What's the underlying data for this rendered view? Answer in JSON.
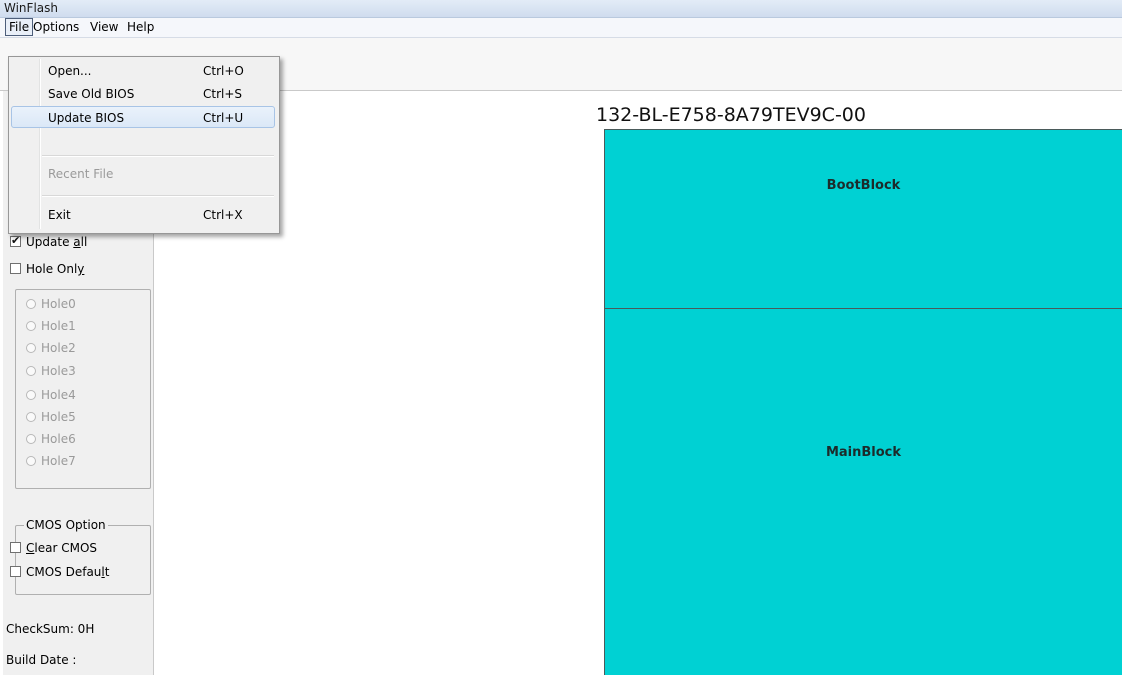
{
  "window": {
    "title": "WinFlash"
  },
  "menubar": {
    "items": [
      "File",
      "Options",
      "View",
      "Help"
    ]
  },
  "file_menu": {
    "open": {
      "label": "Open...",
      "shortcut": "Ctrl+O"
    },
    "save_old_bios": {
      "label": "Save Old BIOS",
      "shortcut": "Ctrl+S"
    },
    "update_bios": {
      "label": "Update BIOS",
      "shortcut": "Ctrl+U"
    },
    "recent_file": {
      "label": "Recent File"
    },
    "exit": {
      "label": "Exit",
      "shortcut": "Ctrl+X"
    }
  },
  "update_options": {
    "update_all": {
      "label_pre": "Update ",
      "label_u": "a",
      "label_post": "ll",
      "checked": true
    },
    "hole_only": {
      "label_pre": "Hole Onl",
      "label_u": "y",
      "checked": false
    },
    "holes": [
      "Hole0",
      "Hole1",
      "Hole2",
      "Hole3",
      "Hole4",
      "Hole5",
      "Hole6",
      "Hole7"
    ]
  },
  "cmos_option": {
    "legend": "CMOS Option",
    "clear_cmos": {
      "label_u": "C",
      "label_post": "lear CMOS",
      "checked": false
    },
    "cmos_default": {
      "label_pre": "CMOS Defau",
      "label_u": "l",
      "label_post": "t",
      "checked": false
    }
  },
  "info": {
    "checksum": "CheckSum:  0H",
    "build_date": "Build Date :"
  },
  "bios_map": {
    "part_number": "132-BL-E758-8A79TEV9C-00",
    "blocks": [
      "BootBlock",
      "MainBlock"
    ],
    "block_color": "#00d1d3"
  }
}
